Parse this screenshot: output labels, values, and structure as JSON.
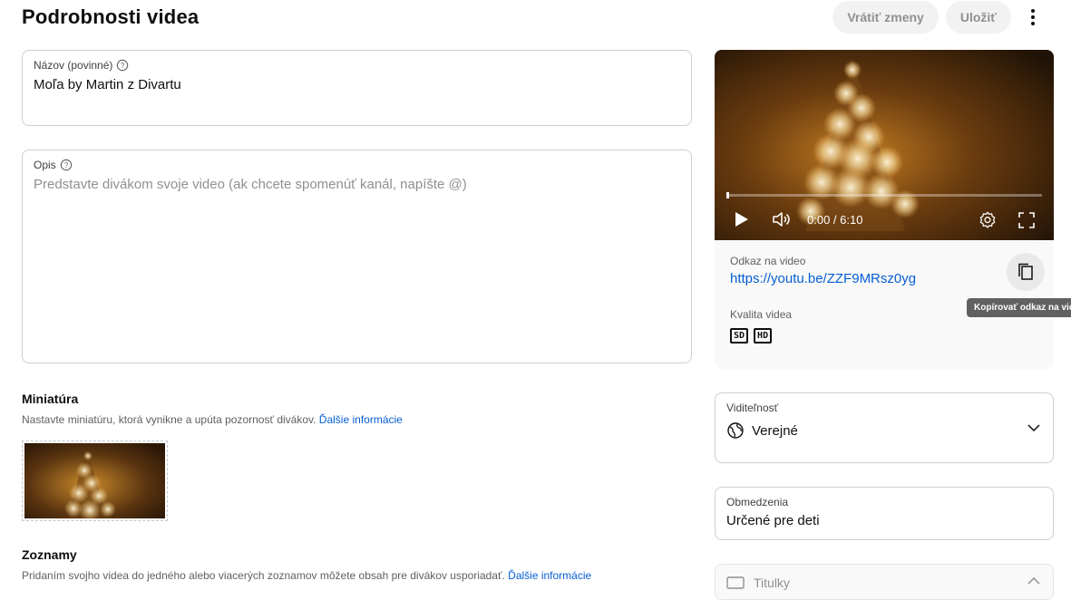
{
  "header": {
    "title": "Podrobnosti videa",
    "undo_label": "Vrátiť zmeny",
    "save_label": "Uložiť"
  },
  "title_field": {
    "label": "Názov (povinné)",
    "value": "Moľa by Martin z Divartu"
  },
  "description_field": {
    "label": "Opis",
    "placeholder": "Predstavte divákom svoje video (ak chcete spomenúť kanál, napíšte @)"
  },
  "thumbnail": {
    "title": "Miniatúra",
    "description": "Nastavte miniatúru, ktorá vynikne a upúta pozornosť divákov.",
    "link": "Ďalšie informácie"
  },
  "playlists": {
    "title": "Zoznamy",
    "description": "Pridaním svojho videa do jedného alebo viacerých zoznamov môžete obsah pre divákov usporiadať.",
    "link": "Ďalšie informácie"
  },
  "video": {
    "time": "0:00 / 6:10",
    "link_label": "Odkaz na video",
    "link_url": "https://youtu.be/ZZF9MRsz0yg",
    "quality_label": "Kvalita videa",
    "quality_badges": [
      "SD",
      "HD"
    ],
    "copy_tooltip": "Kopírovať odkaz na video"
  },
  "visibility": {
    "label": "Viditeľnosť",
    "value": "Verejné"
  },
  "restrictions": {
    "label": "Obmedzenia",
    "value": "Určené pre deti"
  },
  "subtitles": {
    "label": "Titulky"
  },
  "colors": {
    "accent_link": "#065fd4",
    "border": "#cfcfcf",
    "button_bg": "#f2f2f2"
  }
}
